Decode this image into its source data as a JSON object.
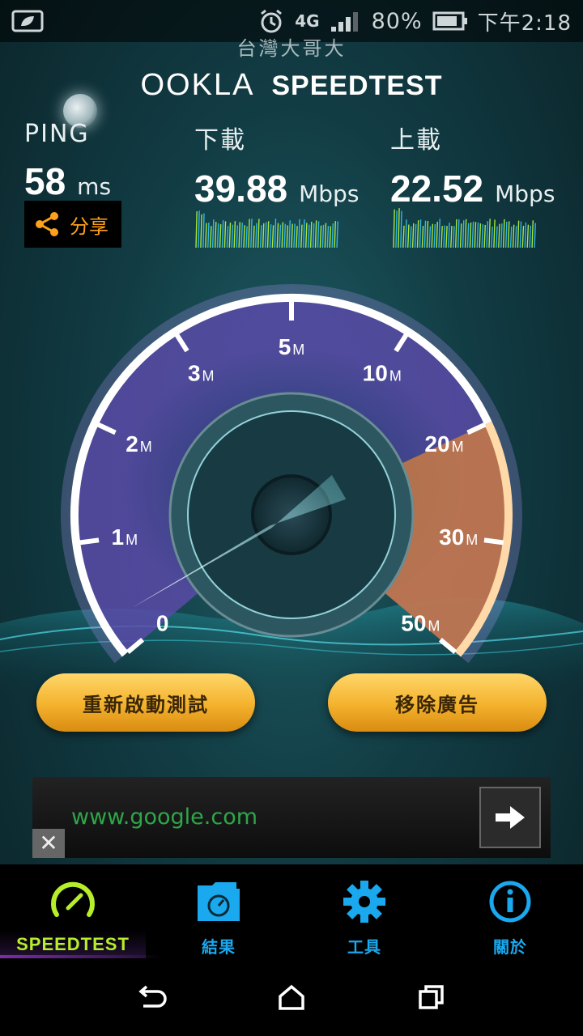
{
  "status_bar": {
    "network": "4G",
    "battery_percent": "80%",
    "time": "下午2:18",
    "carrier": "台灣大哥大",
    "icons": [
      "leaf-icon",
      "alarm-icon",
      "signal-icon",
      "battery-icon"
    ]
  },
  "header": {
    "brand": "OOKLA",
    "product": "SPEEDTEST"
  },
  "metrics": {
    "ping": {
      "label": "PING",
      "value": "58",
      "unit": "ms"
    },
    "download": {
      "label": "下載",
      "value": "39.88",
      "unit": "Mbps"
    },
    "upload": {
      "label": "上載",
      "value": "22.52",
      "unit": "Mbps"
    }
  },
  "share": {
    "label": "分享",
    "icon": "share-icon"
  },
  "gauge": {
    "tick_labels": [
      "0",
      "1",
      "2",
      "3",
      "5",
      "10",
      "20",
      "30",
      "50"
    ],
    "unit_suffix": "M",
    "needle_value_mbps": 0.3
  },
  "buttons": {
    "restart": "重新啟動測試",
    "remove_ads": "移除廣告"
  },
  "ad": {
    "url": "www.google.com",
    "close": "✕"
  },
  "bottom_nav": {
    "items": [
      {
        "label": "SPEEDTEST",
        "icon": "speedometer-icon",
        "active": true
      },
      {
        "label": "結果",
        "icon": "results-folder-icon"
      },
      {
        "label": "工具",
        "icon": "gear-icon"
      },
      {
        "label": "關於",
        "icon": "info-icon"
      }
    ]
  },
  "colors": {
    "accent_orange": "#ffa21a",
    "nav_blue": "#1aa8ee",
    "active_green": "#b6ee2a",
    "button_gold": "#f3b12c"
  }
}
